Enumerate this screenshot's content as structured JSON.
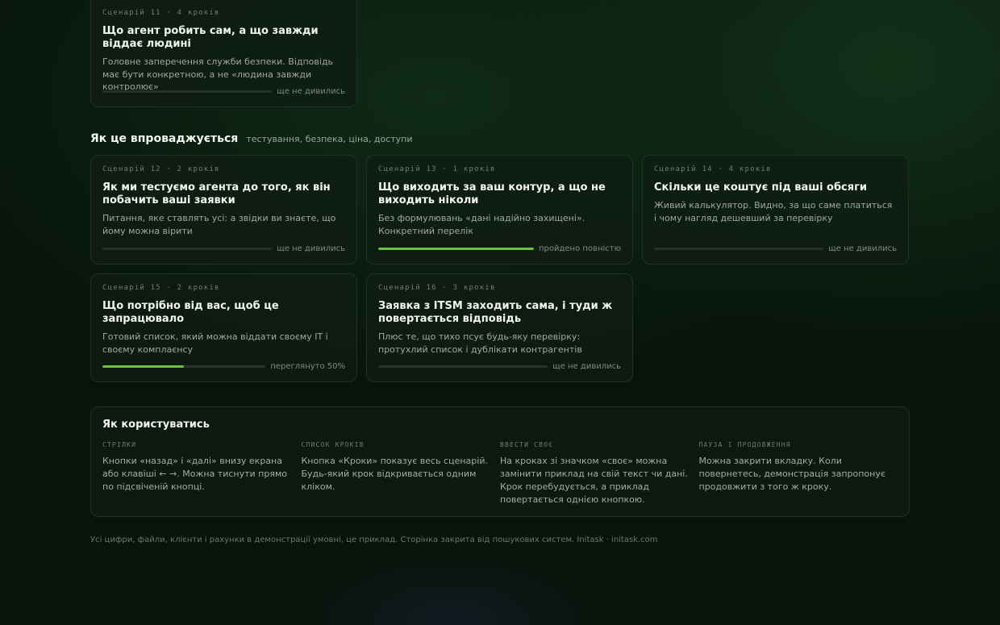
{
  "cards": [
    {
      "meta": "Сценарій 11 · 4 кроків",
      "title": "Що агент робить сам, а що завжди віддає людині",
      "desc": "Головне заперечення служби безпеки. Відповідь має бути конкретною, а не «людина завжди контролює»",
      "status": "ще не дивились",
      "progress": 0
    },
    {
      "meta": "Сценарій 12 · 2 кроків",
      "title": "Як ми тестуємо агента до того, як він побачить ваші заявки",
      "desc": "Питання, яке ставлять усі: а звідки ви знаєте, що йому можна вірити",
      "status": "ще не дивились",
      "progress": 0
    },
    {
      "meta": "Сценарій 13 · 1 кроків",
      "title": "Що виходить за ваш контур, а що не виходить ніколи",
      "desc": "Без формулювань «дані надійно захищені». Конкретний перелік",
      "status": "пройдено повністю",
      "progress": 1
    },
    {
      "meta": "Сценарій 14 · 4 кроків",
      "title": "Скільки це коштує під ваші обсяги",
      "desc": "Живий калькулятор. Видно, за що саме платиться і чому нагляд дешевший за перевірку",
      "status": "ще не дивились",
      "progress": 0
    },
    {
      "meta": "Сценарій 15 · 2 кроків",
      "title": "Що потрібно від вас, щоб це запрацювало",
      "desc": "Готовий список, який можна віддати своєму IT і своєму комплаєнсу",
      "status": "переглянуто 50%",
      "progress": 0.5
    },
    {
      "meta": "Сценарій 16 · 3 кроків",
      "title": "Заявка з ITSM заходить сама, і туди ж повертається відповідь",
      "desc": "Плюс те, що тихо псує будь-яку перевірку: протухлий список і дублікати контрагентів",
      "status": "ще не дивились",
      "progress": 0
    }
  ],
  "section": {
    "title": "Як це впроваджується",
    "subtitle": "тестування, безпека, ціна, доступи"
  },
  "howto": {
    "title": "Як користуватись",
    "cols": [
      {
        "label": "Стрілки",
        "text": "Кнопки «назад» і «далі» внизу екрана або клавіші ← →. Можна тиснути прямо по підсвіченій кнопці."
      },
      {
        "label": "Список кроків",
        "text": "Кнопка «Кроки» показує весь сценарій. Будь-який крок відкривається одним кліком."
      },
      {
        "label": "Ввести своє",
        "text": "На кроках зі значком «своє» можна замінити приклад на свій текст чи дані. Крок перебудується, а приклад повертається однією кнопкою."
      },
      {
        "label": "Пауза і продовження",
        "text": "Можна закрити вкладку. Коли повернетесь, демонстрація запропонує продовжити з того ж кроку."
      }
    ]
  },
  "footer": "Усі цифри, файли, клієнти і рахунки в демонстрації умовні, це приклад. Сторінка закрита від пошукових систем. Initask · initask.com",
  "colors": {
    "accent": "#6fbf3f",
    "background": "#07140b"
  }
}
